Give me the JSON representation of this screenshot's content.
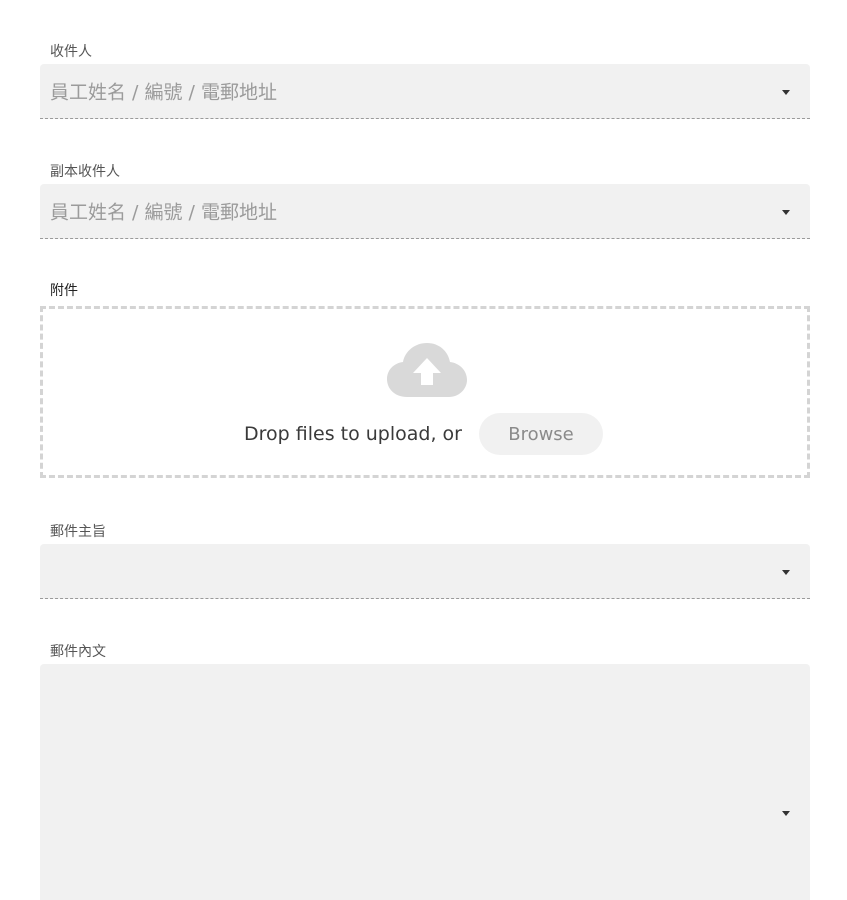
{
  "to": {
    "label": "收件人",
    "placeholder": "員工姓名 / 編號 / 電郵地址"
  },
  "cc": {
    "label": "副本收件人",
    "placeholder": "員工姓名 / 編號 / 電郵地址"
  },
  "attachment": {
    "label": "附件",
    "drop_text": "Drop files to upload, or",
    "browse_label": "Browse",
    "icon": "cloud-upload-icon"
  },
  "subject": {
    "label": "郵件主旨",
    "value": ""
  },
  "body": {
    "label": "郵件內文",
    "value": ""
  },
  "colors": {
    "field_bg": "#f1f1f1",
    "placeholder": "#9b9b9b",
    "dropzone_border": "#d4d4d4",
    "cloud": "#d9d9d9"
  }
}
